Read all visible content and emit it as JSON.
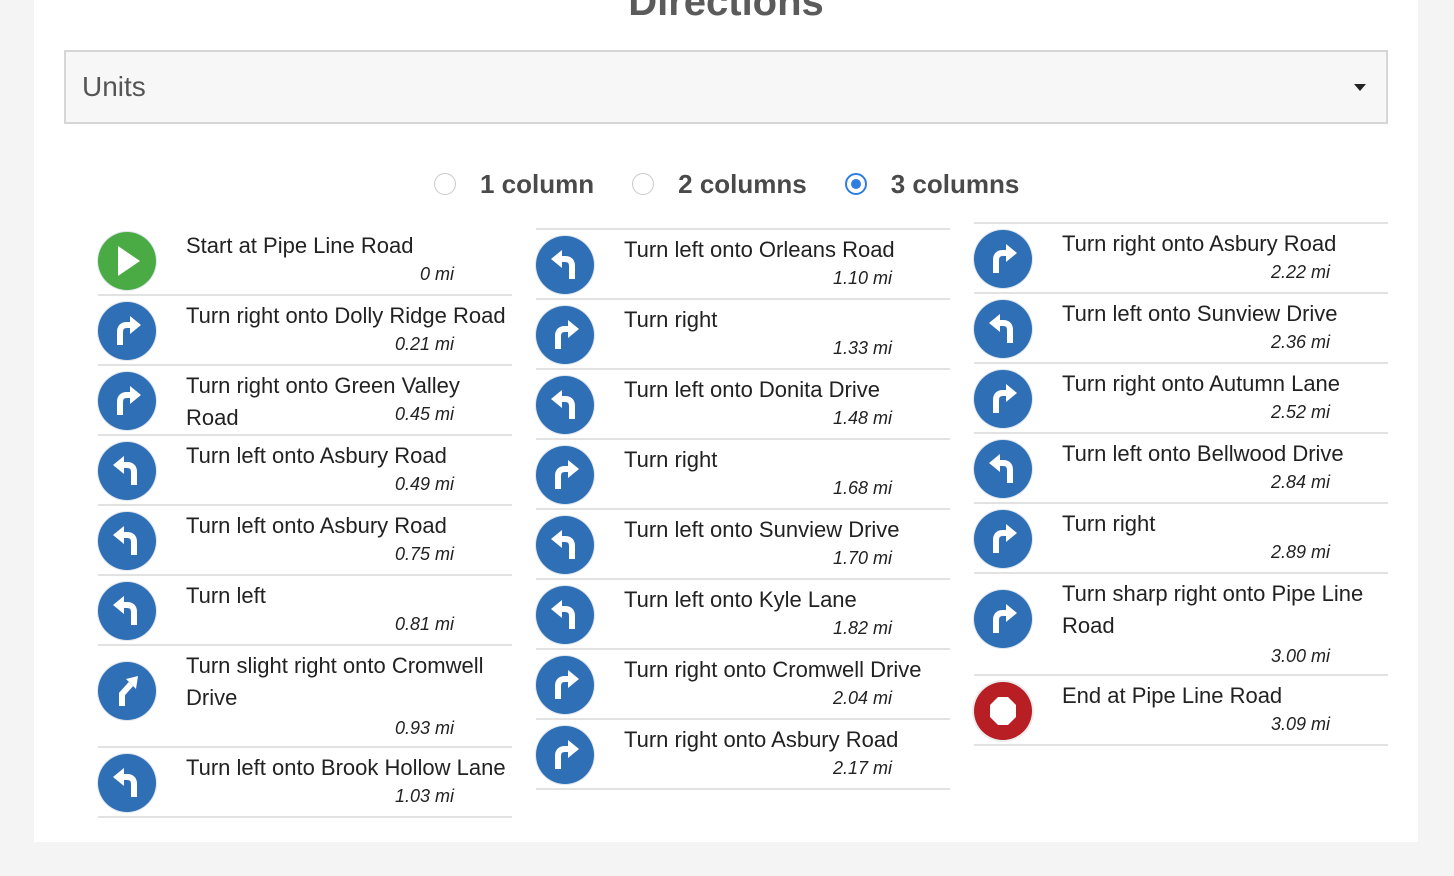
{
  "header": {
    "title": "Directions"
  },
  "units": {
    "label": "Units"
  },
  "layout_options": [
    {
      "label": "1 column",
      "selected": false
    },
    {
      "label": "2 columns",
      "selected": false
    },
    {
      "label": "3 columns",
      "selected": true
    }
  ],
  "colors": {
    "accent": "#2f6fb5",
    "start": "#4aab45",
    "end": "#b71f25",
    "radio": "#2f7de1"
  },
  "columns": [
    {
      "steps": [
        {
          "icon": "start-icon",
          "text": "Start at Pipe Line Road",
          "dist": "0 mi"
        },
        {
          "icon": "turn-right-icon",
          "text": "Turn right onto Dolly Ridge Road",
          "dist": "0.21 mi"
        },
        {
          "icon": "turn-right-icon",
          "text": "Turn right onto Green Valley Road",
          "dist": "0.45 mi"
        },
        {
          "icon": "turn-left-icon",
          "text": "Turn left onto Asbury Road",
          "dist": "0.49 mi"
        },
        {
          "icon": "turn-left-icon",
          "text": "Turn left onto Asbury Road",
          "dist": "0.75 mi"
        },
        {
          "icon": "turn-left-icon",
          "text": "Turn left",
          "dist": "0.81 mi"
        },
        {
          "icon": "slight-right-icon",
          "text": "Turn slight right onto Cromwell Drive",
          "dist": "0.93 mi"
        },
        {
          "icon": "turn-left-icon",
          "text": "Turn left onto Brook Hollow Lane",
          "dist": "1.03 mi"
        }
      ]
    },
    {
      "steps": [
        {
          "icon": "turn-left-icon",
          "text": "Turn left onto Orleans Road",
          "dist": "1.10 mi"
        },
        {
          "icon": "turn-right-icon",
          "text": "Turn right",
          "dist": "1.33 mi"
        },
        {
          "icon": "turn-left-icon",
          "text": "Turn left onto Donita Drive",
          "dist": "1.48 mi"
        },
        {
          "icon": "turn-right-icon",
          "text": "Turn right",
          "dist": "1.68 mi"
        },
        {
          "icon": "turn-left-icon",
          "text": "Turn left onto Sunview Drive",
          "dist": "1.70 mi"
        },
        {
          "icon": "turn-left-icon",
          "text": "Turn left onto Kyle Lane",
          "dist": "1.82 mi"
        },
        {
          "icon": "turn-right-icon",
          "text": "Turn right onto Cromwell Drive",
          "dist": "2.04 mi"
        },
        {
          "icon": "turn-right-icon",
          "text": "Turn right onto Asbury Road",
          "dist": "2.17 mi"
        }
      ]
    },
    {
      "steps": [
        {
          "icon": "turn-right-icon",
          "text": "Turn right onto Asbury Road",
          "dist": "2.22 mi"
        },
        {
          "icon": "turn-left-icon",
          "text": "Turn left onto Sunview Drive",
          "dist": "2.36 mi"
        },
        {
          "icon": "turn-right-icon",
          "text": "Turn right onto Autumn Lane",
          "dist": "2.52 mi"
        },
        {
          "icon": "turn-left-icon",
          "text": "Turn left onto Bellwood Drive",
          "dist": "2.84 mi"
        },
        {
          "icon": "turn-right-icon",
          "text": "Turn right",
          "dist": "2.89 mi"
        },
        {
          "icon": "turn-right-icon",
          "text": "Turn sharp right onto Pipe Line Road",
          "dist": "3.00 mi"
        },
        {
          "icon": "end-icon",
          "text": "End at Pipe Line Road",
          "dist": "3.09 mi"
        }
      ]
    }
  ]
}
